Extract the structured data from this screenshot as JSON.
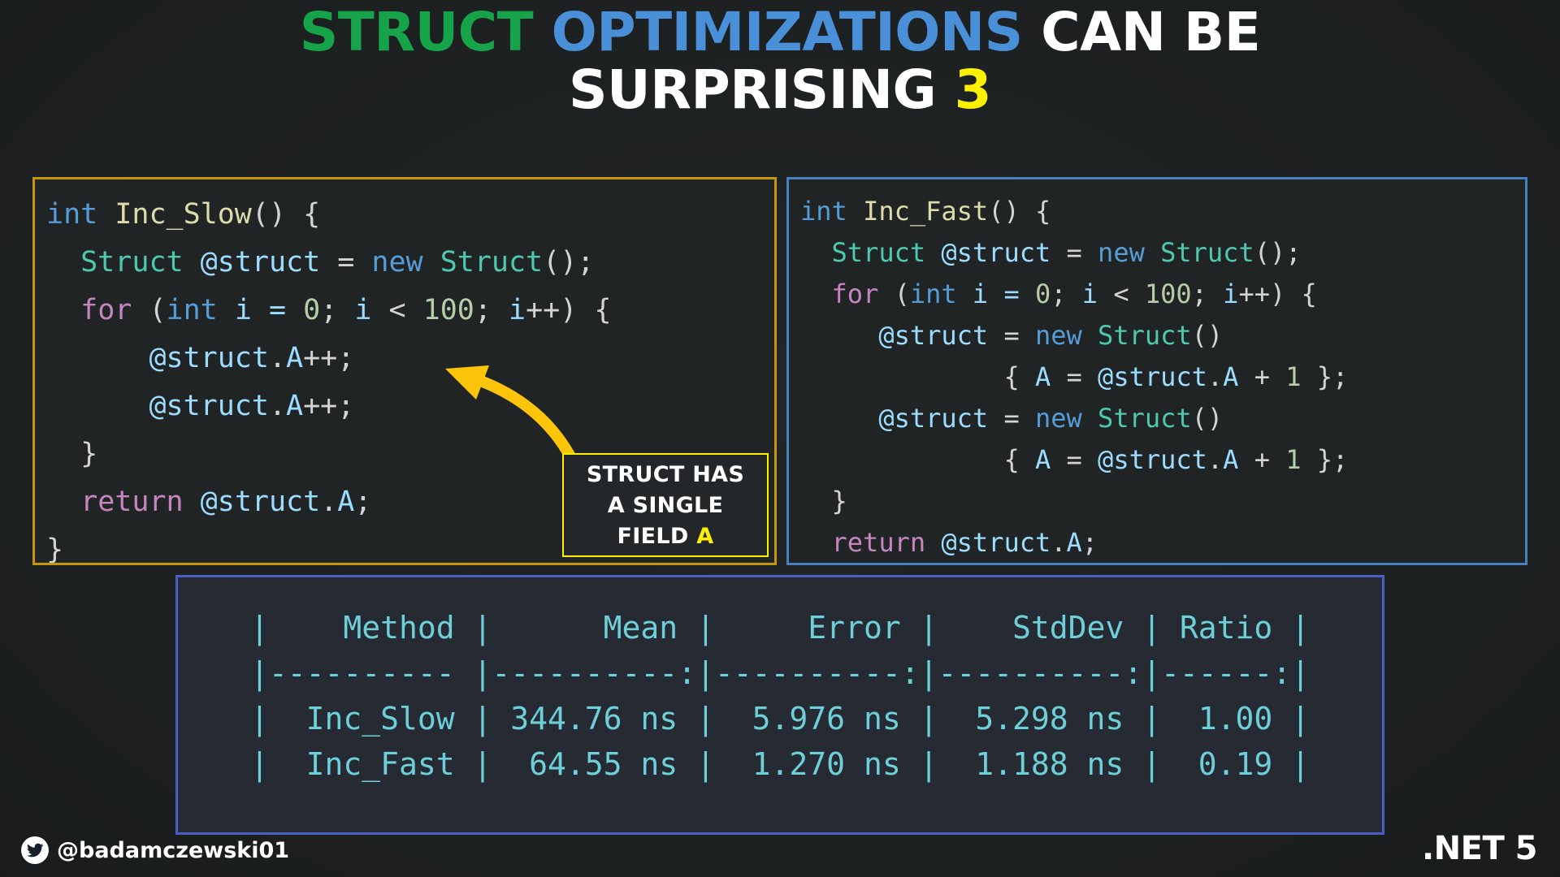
{
  "title": {
    "line1_part1": "STRUCT",
    "line1_part2": "OPTIMIZATIONS",
    "line1_part3": "CAN BE",
    "line2_part1": "SURPRISING",
    "line2_part2": "3",
    "colors": {
      "struct": "#16a34a",
      "optimizations": "#4a90d9",
      "plain": "#ffffff",
      "number": "#fff000"
    }
  },
  "code_left": {
    "border_color": "#c8960c",
    "lines": [
      [
        {
          "t": "int",
          "c": "k-type"
        },
        {
          "t": " ",
          "c": "k-punc"
        },
        {
          "t": "Inc_Slow",
          "c": "k-fn"
        },
        {
          "t": "() {",
          "c": "k-punc"
        }
      ],
      [
        {
          "t": "  ",
          "c": "k-punc"
        },
        {
          "t": "Struct",
          "c": "k-class"
        },
        {
          "t": " ",
          "c": "k-punc"
        },
        {
          "t": "@struct",
          "c": "k-var"
        },
        {
          "t": " = ",
          "c": "k-punc"
        },
        {
          "t": "new",
          "c": "k-new"
        },
        {
          "t": " ",
          "c": "k-punc"
        },
        {
          "t": "Struct",
          "c": "k-class"
        },
        {
          "t": "();",
          "c": "k-punc"
        }
      ],
      [
        {
          "t": "  ",
          "c": "k-punc"
        },
        {
          "t": "for",
          "c": "k-kw"
        },
        {
          "t": " (",
          "c": "k-punc"
        },
        {
          "t": "int",
          "c": "k-type"
        },
        {
          "t": " i = ",
          "c": "k-var"
        },
        {
          "t": "0",
          "c": "k-num"
        },
        {
          "t": "; ",
          "c": "k-punc"
        },
        {
          "t": "i",
          "c": "k-var"
        },
        {
          "t": " < ",
          "c": "k-punc"
        },
        {
          "t": "100",
          "c": "k-num"
        },
        {
          "t": "; ",
          "c": "k-punc"
        },
        {
          "t": "i",
          "c": "k-var"
        },
        {
          "t": "++) {",
          "c": "k-punc"
        }
      ],
      [
        {
          "t": "      ",
          "c": "k-punc"
        },
        {
          "t": "@struct",
          "c": "k-var"
        },
        {
          "t": ".",
          "c": "k-punc"
        },
        {
          "t": "A",
          "c": "k-var"
        },
        {
          "t": "++;",
          "c": "k-punc"
        }
      ],
      [
        {
          "t": "      ",
          "c": "k-punc"
        },
        {
          "t": "@struct",
          "c": "k-var"
        },
        {
          "t": ".",
          "c": "k-punc"
        },
        {
          "t": "A",
          "c": "k-var"
        },
        {
          "t": "++;",
          "c": "k-punc"
        }
      ],
      [
        {
          "t": "  }",
          "c": "k-punc"
        }
      ],
      [
        {
          "t": "  ",
          "c": "k-punc"
        },
        {
          "t": "return",
          "c": "k-kw"
        },
        {
          "t": " ",
          "c": "k-punc"
        },
        {
          "t": "@struct",
          "c": "k-var"
        },
        {
          "t": ".",
          "c": "k-punc"
        },
        {
          "t": "A",
          "c": "k-var"
        },
        {
          "t": ";",
          "c": "k-punc"
        }
      ],
      [
        {
          "t": "}",
          "c": "k-punc"
        }
      ]
    ]
  },
  "code_right": {
    "border_color": "#4a7fc1",
    "lines": [
      [
        {
          "t": "int",
          "c": "k-type"
        },
        {
          "t": " ",
          "c": "k-punc"
        },
        {
          "t": "Inc_Fast",
          "c": "k-fn"
        },
        {
          "t": "() {",
          "c": "k-punc"
        }
      ],
      [
        {
          "t": "  ",
          "c": "k-punc"
        },
        {
          "t": "Struct",
          "c": "k-class"
        },
        {
          "t": " ",
          "c": "k-punc"
        },
        {
          "t": "@struct",
          "c": "k-var"
        },
        {
          "t": " = ",
          "c": "k-punc"
        },
        {
          "t": "new",
          "c": "k-new"
        },
        {
          "t": " ",
          "c": "k-punc"
        },
        {
          "t": "Struct",
          "c": "k-class"
        },
        {
          "t": "();",
          "c": "k-punc"
        }
      ],
      [
        {
          "t": "  ",
          "c": "k-punc"
        },
        {
          "t": "for",
          "c": "k-kw"
        },
        {
          "t": " (",
          "c": "k-punc"
        },
        {
          "t": "int",
          "c": "k-type"
        },
        {
          "t": " i = ",
          "c": "k-var"
        },
        {
          "t": "0",
          "c": "k-num"
        },
        {
          "t": "; ",
          "c": "k-punc"
        },
        {
          "t": "i",
          "c": "k-var"
        },
        {
          "t": " < ",
          "c": "k-punc"
        },
        {
          "t": "100",
          "c": "k-num"
        },
        {
          "t": "; ",
          "c": "k-punc"
        },
        {
          "t": "i",
          "c": "k-var"
        },
        {
          "t": "++) {",
          "c": "k-punc"
        }
      ],
      [
        {
          "t": "     ",
          "c": "k-punc"
        },
        {
          "t": "@struct",
          "c": "k-var"
        },
        {
          "t": " = ",
          "c": "k-punc"
        },
        {
          "t": "new",
          "c": "k-new"
        },
        {
          "t": " ",
          "c": "k-punc"
        },
        {
          "t": "Struct",
          "c": "k-class"
        },
        {
          "t": "()",
          "c": "k-punc"
        }
      ],
      [
        {
          "t": "             { ",
          "c": "k-punc"
        },
        {
          "t": "A",
          "c": "k-var"
        },
        {
          "t": " = ",
          "c": "k-punc"
        },
        {
          "t": "@struct",
          "c": "k-var"
        },
        {
          "t": ".",
          "c": "k-punc"
        },
        {
          "t": "A",
          "c": "k-var"
        },
        {
          "t": " + ",
          "c": "k-punc"
        },
        {
          "t": "1",
          "c": "k-num"
        },
        {
          "t": " };",
          "c": "k-punc"
        }
      ],
      [
        {
          "t": "     ",
          "c": "k-punc"
        },
        {
          "t": "@struct",
          "c": "k-var"
        },
        {
          "t": " = ",
          "c": "k-punc"
        },
        {
          "t": "new",
          "c": "k-new"
        },
        {
          "t": " ",
          "c": "k-punc"
        },
        {
          "t": "Struct",
          "c": "k-class"
        },
        {
          "t": "()",
          "c": "k-punc"
        }
      ],
      [
        {
          "t": "             { ",
          "c": "k-punc"
        },
        {
          "t": "A",
          "c": "k-var"
        },
        {
          "t": " = ",
          "c": "k-punc"
        },
        {
          "t": "@struct",
          "c": "k-var"
        },
        {
          "t": ".",
          "c": "k-punc"
        },
        {
          "t": "A",
          "c": "k-var"
        },
        {
          "t": " + ",
          "c": "k-punc"
        },
        {
          "t": "1",
          "c": "k-num"
        },
        {
          "t": " };",
          "c": "k-punc"
        }
      ],
      [
        {
          "t": "  }",
          "c": "k-punc"
        }
      ],
      [
        {
          "t": "  ",
          "c": "k-punc"
        },
        {
          "t": "return",
          "c": "k-kw"
        },
        {
          "t": " ",
          "c": "k-punc"
        },
        {
          "t": "@struct",
          "c": "k-var"
        },
        {
          "t": ".",
          "c": "k-punc"
        },
        {
          "t": "A",
          "c": "k-var"
        },
        {
          "t": ";",
          "c": "k-punc"
        }
      ]
    ]
  },
  "callout": {
    "line1": "STRUCT HAS",
    "line2": "A SINGLE",
    "line3_prefix": "FIELD ",
    "line3_highlight": "A",
    "border_color": "#fff000",
    "highlight_color": "#fff000"
  },
  "arrow": {
    "color": "#fdc50a",
    "name": "curved-arrow-pointing-to-struct-a-increment"
  },
  "benchmark_table": {
    "border_color": "#4a5fc1",
    "text_color": "#6ecfd8",
    "columns": [
      "Method",
      "Mean",
      "Error",
      "StdDev",
      "Ratio"
    ],
    "raw_lines": [
      "|    Method |      Mean |     Error |    StdDev | Ratio |",
      "|---------- |----------:|----------:|----------:|------:|",
      "|  Inc_Slow | 344.76 ns |  5.976 ns |  5.298 ns |  1.00 |",
      "|  Inc_Fast |  64.55 ns |  1.270 ns |  1.188 ns |  0.19 |"
    ],
    "rows": [
      {
        "method": "Inc_Slow",
        "mean": "344.76 ns",
        "error": "5.976 ns",
        "stddev": "5.298 ns",
        "ratio": "1.00"
      },
      {
        "method": "Inc_Fast",
        "mean": "64.55 ns",
        "error": "1.270 ns",
        "stddev": "1.188 ns",
        "ratio": "0.19"
      }
    ]
  },
  "footer": {
    "twitter_handle": "@badamczewski01",
    "dotnet_badge": ".NET 5"
  }
}
